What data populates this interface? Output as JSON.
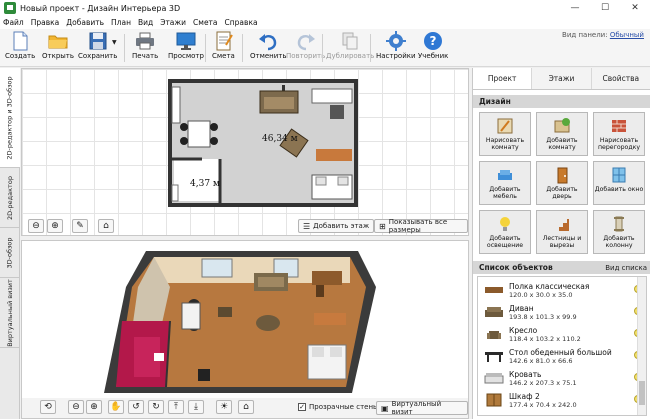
{
  "window": {
    "title": "Новый проект - Дизайн Интерьера 3D",
    "minimize": "—",
    "maximize": "☐",
    "close": "✕"
  },
  "menu": [
    "Файл",
    "Правка",
    "Добавить",
    "План",
    "Вид",
    "Этажи",
    "Смета",
    "Справка"
  ],
  "toolbar": {
    "create": "Создать",
    "open": "Открыть",
    "save": "Сохранить",
    "print": "Печать",
    "preview": "Просмотр",
    "estimate": "Смета",
    "undo": "Отменить",
    "redo": "Повторить",
    "duplicate": "Дублировать",
    "settings": "Настройки",
    "tutorial": "Учебник",
    "panel_view_label": "Вид панели:",
    "panel_view_value": "Обычный"
  },
  "vtabs": [
    "2D-редактор и 3D-обзор",
    "2D-редактор",
    "3D-обзор",
    "Виртуальный визит"
  ],
  "plan": {
    "area_main": "46,34 м",
    "area_small": "4,37 м"
  },
  "view2d_bar": {
    "add_floor": "Добавить этаж",
    "show_sizes": "Показывать все размеры"
  },
  "view3d_bar": {
    "transparent_walls": "Прозрачные стены",
    "transparent_checked": true,
    "virtual_visit": "Виртуальный визит"
  },
  "rpanel": {
    "tabs": [
      "Проект",
      "Этажи",
      "Свойства"
    ],
    "section_design": "Дизайн",
    "tiles": [
      {
        "label": "Нарисовать комнату",
        "icon": "pencil-icon"
      },
      {
        "label": "Добавить комнату",
        "icon": "room-add-icon"
      },
      {
        "label": "Нарисовать перегородку",
        "icon": "brick-wall-icon"
      },
      {
        "label": "Добавить мебель",
        "icon": "sofa-icon"
      },
      {
        "label": "Добавить дверь",
        "icon": "door-icon"
      },
      {
        "label": "Добавить окно",
        "icon": "window-icon"
      },
      {
        "label": "Добавить освещение",
        "icon": "bulb-icon"
      },
      {
        "label": "Лестницы и вырезы",
        "icon": "stairs-icon"
      },
      {
        "label": "Добавить колонну",
        "icon": "column-icon"
      }
    ],
    "section_objects": "Список объектов",
    "list_view": "Вид списка",
    "objects": [
      {
        "name": "Полка классическая",
        "size": "120.0 x 30.0 x 35.0"
      },
      {
        "name": "Диван",
        "size": "193.8 x 101.3 x 99.9"
      },
      {
        "name": "Кресло",
        "size": "118.4 x 103.2 x 110.2"
      },
      {
        "name": "Стол обеденный большой",
        "size": "142.6 x 81.0 x 66.6"
      },
      {
        "name": "Кровать",
        "size": "146.2 x 207.3 x 75.1"
      },
      {
        "name": "Шкаф 2",
        "size": "177.4 x 70.4 x 242.0"
      }
    ]
  }
}
